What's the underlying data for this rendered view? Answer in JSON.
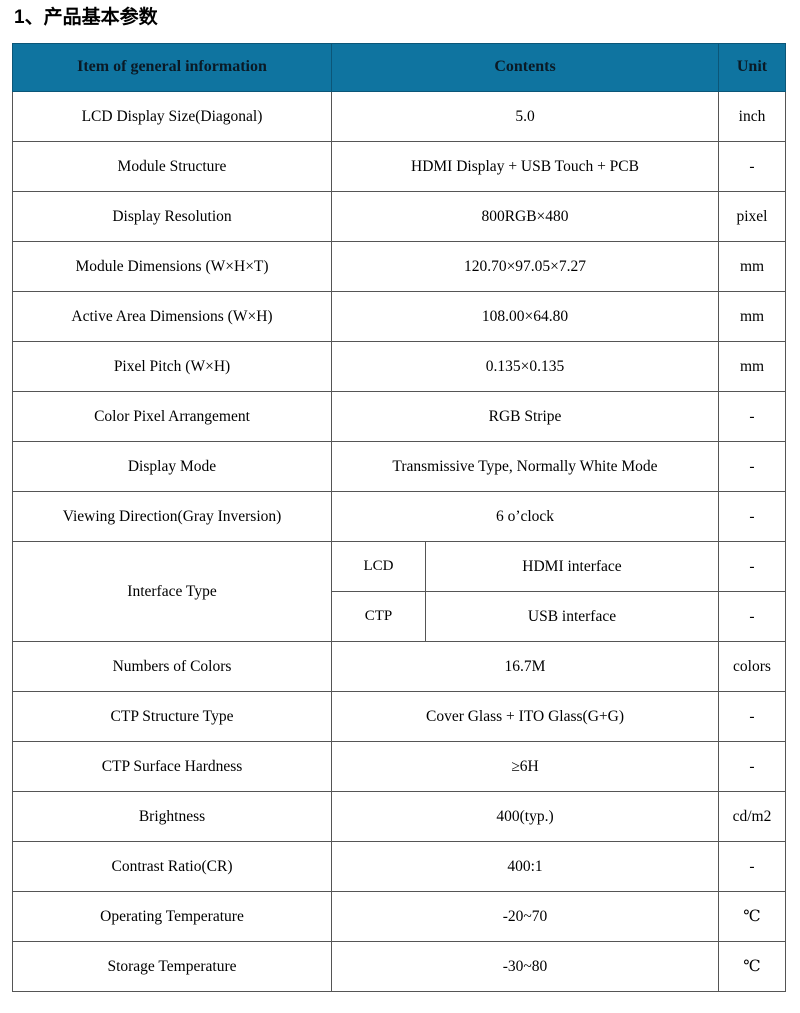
{
  "document": {
    "section_number": "1、",
    "title": "1、产品基本参数"
  },
  "colors": {
    "header_bg": "#0f74a0",
    "header_text": "#0a1a26",
    "highlight_text": "#ff0000",
    "border": "#555555",
    "page_bg": "#ffffff"
  },
  "table": {
    "headers": {
      "item": "Item of general information",
      "contents": "Contents",
      "unit": "Unit"
    },
    "rows": [
      {
        "item": "LCD Display Size(Diagonal)",
        "value": "5.0",
        "unit": "inch",
        "highlight": false
      },
      {
        "item": "Module Structure",
        "value": "HDMI Display + USB Touch + PCB",
        "unit": "-",
        "highlight": true
      },
      {
        "item": "Display Resolution",
        "value": "800RGB×480",
        "unit": "pixel",
        "highlight": false
      },
      {
        "item": "Module Dimensions (W×H×T)",
        "value": "120.70×97.05×7.27",
        "unit": "mm",
        "highlight": false
      },
      {
        "item": "Active Area Dimensions (W×H)",
        "value": "108.00×64.80",
        "unit": "mm",
        "highlight": false
      },
      {
        "item": "Pixel Pitch (W×H)",
        "value": "0.135×0.135",
        "unit": "mm",
        "highlight": false
      },
      {
        "item": "Color Pixel Arrangement",
        "value": "RGB Stripe",
        "unit": "-",
        "highlight": false
      },
      {
        "item": "Display Mode",
        "value": "Transmissive Type, Normally White Mode",
        "unit": "-",
        "highlight": false
      },
      {
        "item": "Viewing Direction(Gray Inversion)",
        "value": "6 o’clock",
        "unit": "-",
        "highlight": false
      }
    ],
    "interface_group": {
      "item": "Interface Type",
      "subrows": [
        {
          "sub_label": "LCD",
          "value": "HDMI interface",
          "unit": "-",
          "highlight": true
        },
        {
          "sub_label": "CTP",
          "value": "USB interface",
          "unit": "-",
          "highlight": true
        }
      ]
    },
    "rows_after": [
      {
        "item": "Numbers of Colors",
        "value": "16.7M",
        "unit": "colors",
        "highlight": false
      },
      {
        "item": "CTP Structure Type",
        "value": "Cover Glass + ITO Glass(G+G)",
        "unit": "-",
        "highlight": false
      },
      {
        "item": "CTP Surface Hardness",
        "value": "≥6H",
        "unit": "-",
        "highlight": false
      },
      {
        "item": "Brightness",
        "value": "400(typ.)",
        "unit": "cd/m2",
        "highlight": false
      },
      {
        "item": "Contrast Ratio(CR)",
        "value": "400:1",
        "unit": "-",
        "highlight": false
      },
      {
        "item": "Operating Temperature",
        "value": "-20~70",
        "unit": "℃",
        "highlight": false
      },
      {
        "item": "Storage Temperature",
        "value": "-30~80",
        "unit": "℃",
        "highlight": false
      }
    ]
  }
}
